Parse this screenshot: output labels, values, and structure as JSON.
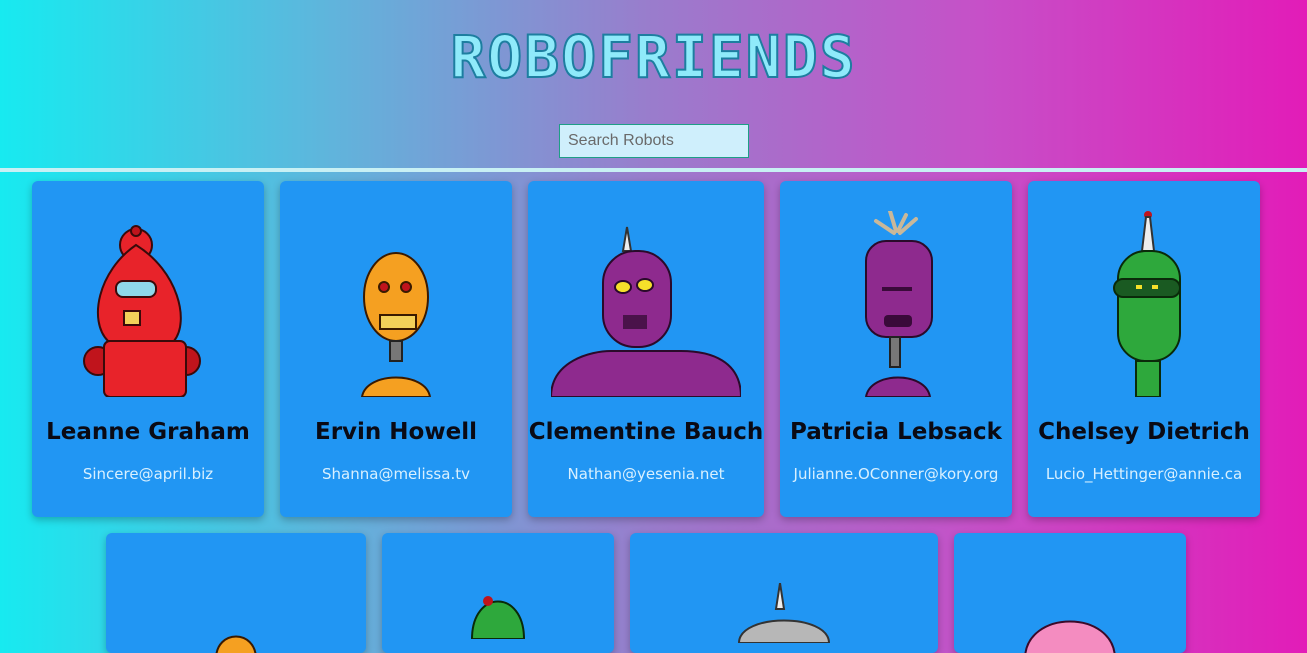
{
  "app": {
    "title": "ROBOFRIENDS"
  },
  "search": {
    "placeholder": "Search Robots",
    "value": ""
  },
  "robots": [
    {
      "name": "Leanne Graham",
      "email": "Sincere@april.biz",
      "color": "#e8232a"
    },
    {
      "name": "Ervin Howell",
      "email": "Shanna@melissa.tv",
      "color": "#f5a021"
    },
    {
      "name": "Clementine Bauch",
      "email": "Nathan@yesenia.net",
      "color": "#8e2a8e"
    },
    {
      "name": "Patricia Lebsack",
      "email": "Julianne.OConner@kory.org",
      "color": "#8e2a8e"
    },
    {
      "name": "Chelsey Dietrich",
      "email": "Lucio_Hettinger@annie.ca",
      "color": "#2ea83c"
    }
  ],
  "colors": {
    "card": "#2196f3",
    "title": "#8feafa",
    "gradient_start": "#17eaf0",
    "gradient_end": "#e21cb8"
  }
}
